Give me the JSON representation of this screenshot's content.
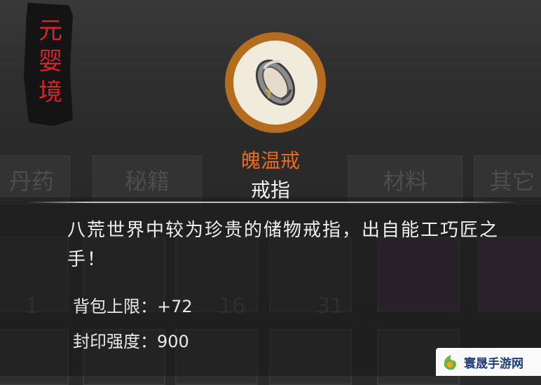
{
  "realm_badge": {
    "text": "元婴境"
  },
  "item": {
    "name": "魄温戒",
    "type": "戒指",
    "description": "八荒世界中较为珍贵的储物戒指，出自能工巧匠之手！",
    "stats": [
      {
        "label": "背包上限：",
        "value": "+72"
      },
      {
        "label": "封印强度：",
        "value": "900"
      }
    ]
  },
  "background": {
    "tabs": [
      "丹药",
      "秘籍",
      "材料",
      "其它"
    ],
    "slot_counts": [
      "1",
      "16",
      "31"
    ]
  },
  "colors": {
    "realm_red": "#d8232a",
    "item_name_orange": "#ec6a1f",
    "icon_frame": "#b46d1e"
  },
  "watermark": {
    "text": "寰晟手游网"
  }
}
